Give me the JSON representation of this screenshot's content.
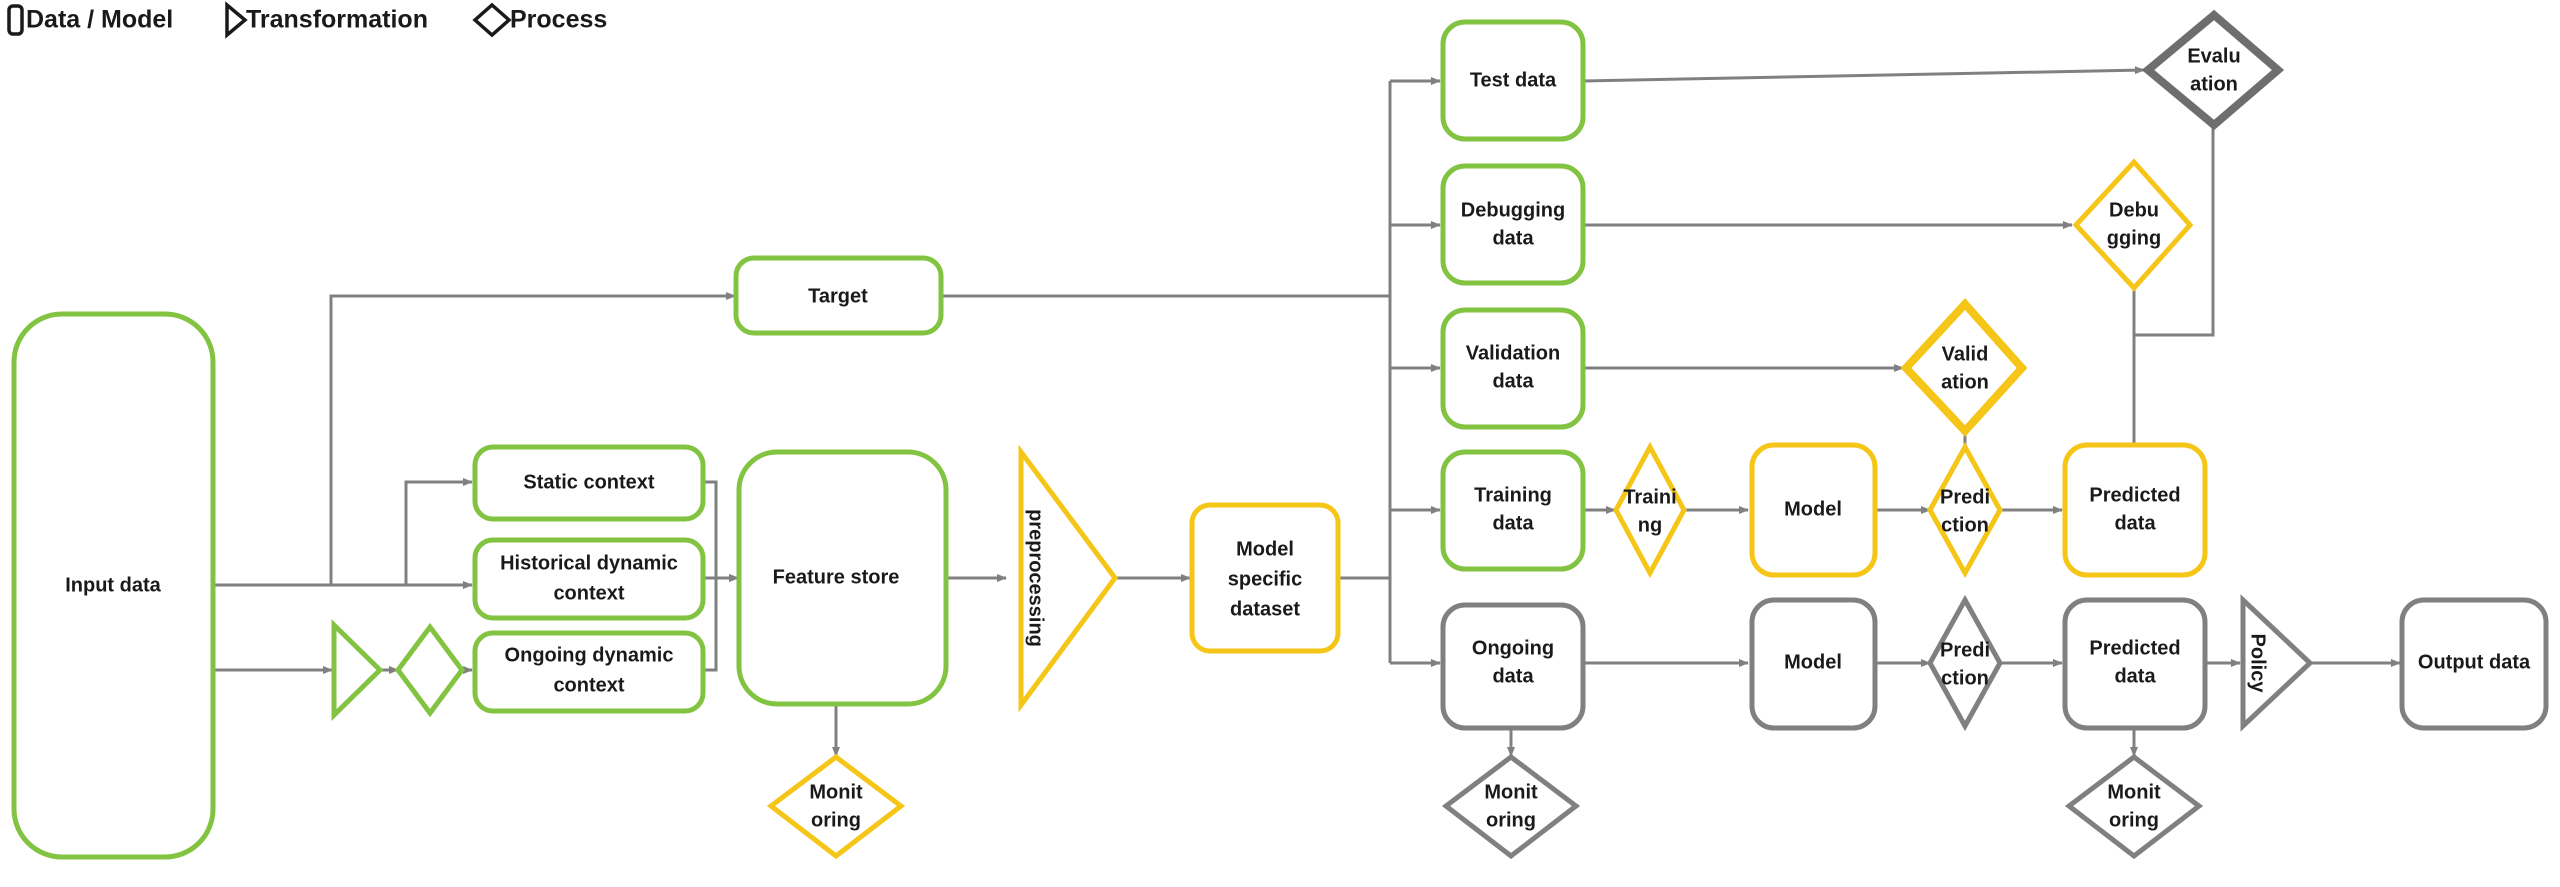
{
  "legend": {
    "items": [
      {
        "id": "data-model",
        "label": "Data / Model",
        "shape": "rounded-rect"
      },
      {
        "id": "transformation",
        "label": "Transformation",
        "shape": "triangle"
      },
      {
        "id": "process",
        "label": "Process",
        "shape": "diamond"
      }
    ]
  },
  "colors": {
    "green": "#82C341",
    "yellow": "#F5C518",
    "gray": "#808080",
    "dark_gray": "#6E6E6E",
    "edge": "#808080",
    "text": "#1A1A1A",
    "background": "#FFFFFF"
  },
  "nodes": {
    "input_data": {
      "label": "Input data",
      "shape": "rounded-rect",
      "color": "green"
    },
    "target": {
      "label": "Target",
      "shape": "rounded-rect",
      "color": "green"
    },
    "static_context": {
      "label": "Static context",
      "shape": "rounded-rect",
      "color": "green"
    },
    "historical_dynamic_context": {
      "label": "Historical dynamic\ncontext",
      "lines": [
        "Historical dynamic",
        "context"
      ],
      "shape": "rounded-rect",
      "color": "green"
    },
    "ongoing_dynamic_context": {
      "label": "Ongoing dynamic\ncontext",
      "lines": [
        "Ongoing dynamic",
        "context"
      ],
      "shape": "rounded-rect",
      "color": "green"
    },
    "ingest_transformation": {
      "label": "",
      "shape": "triangle",
      "color": "green"
    },
    "ingest_process": {
      "label": "",
      "shape": "diamond",
      "color": "green"
    },
    "feature_store": {
      "label": "Feature store",
      "shape": "rounded-rect",
      "color": "green"
    },
    "preprocessing": {
      "label": "preprocessing",
      "shape": "triangle",
      "color": "yellow",
      "rotated_text": true
    },
    "monitoring_feature_store": {
      "label": "Monitoring",
      "lines": [
        "Monit",
        "oring"
      ],
      "shape": "diamond",
      "color": "yellow"
    },
    "model_specific_dataset": {
      "label": "Model specific dataset",
      "lines": [
        "Model",
        "specific",
        "dataset"
      ],
      "shape": "rounded-rect",
      "color": "yellow"
    },
    "test_data": {
      "label": "Test data",
      "shape": "rounded-rect",
      "color": "green"
    },
    "debugging_data": {
      "label": "Debugging data",
      "lines": [
        "Debugging",
        "data"
      ],
      "shape": "rounded-rect",
      "color": "green"
    },
    "validation_data": {
      "label": "Validation data",
      "lines": [
        "Validation",
        "data"
      ],
      "shape": "rounded-rect",
      "color": "green"
    },
    "training_data": {
      "label": "Training data",
      "lines": [
        "Training",
        "data"
      ],
      "shape": "rounded-rect",
      "color": "green"
    },
    "ongoing_data": {
      "label": "Ongoing data",
      "lines": [
        "Ongoing",
        "data"
      ],
      "shape": "rounded-rect",
      "color": "gray"
    },
    "training_process": {
      "label": "Training",
      "lines": [
        "Traini",
        "ng"
      ],
      "shape": "diamond",
      "color": "yellow"
    },
    "model_train": {
      "label": "Model",
      "shape": "rounded-rect",
      "color": "yellow"
    },
    "prediction_train": {
      "label": "Prediction",
      "lines": [
        "Predi",
        "ction"
      ],
      "shape": "diamond",
      "color": "yellow"
    },
    "predicted_data_train": {
      "label": "Predicted data",
      "lines": [
        "Predicted",
        "data"
      ],
      "shape": "rounded-rect",
      "color": "yellow"
    },
    "validation_process": {
      "label": "Validation",
      "lines": [
        "Valid",
        "ation"
      ],
      "shape": "diamond",
      "color": "yellow"
    },
    "debugging_process": {
      "label": "Debugging",
      "lines": [
        "Debu",
        "gging"
      ],
      "shape": "diamond",
      "color": "yellow"
    },
    "evaluation_process": {
      "label": "Evaluation",
      "lines": [
        "Evalu",
        "ation"
      ],
      "shape": "diamond",
      "color": "dark_gray"
    },
    "model_serve": {
      "label": "Model",
      "shape": "rounded-rect",
      "color": "gray"
    },
    "prediction_serve": {
      "label": "Prediction",
      "lines": [
        "Predi",
        "ction"
      ],
      "shape": "diamond",
      "color": "gray"
    },
    "predicted_data_serve": {
      "label": "Predicted data",
      "lines": [
        "Predicted",
        "data"
      ],
      "shape": "rounded-rect",
      "color": "gray"
    },
    "policy": {
      "label": "Policy",
      "shape": "triangle",
      "color": "gray",
      "rotated_text": true
    },
    "output_data": {
      "label": "Output data",
      "shape": "rounded-rect",
      "color": "gray"
    },
    "monitoring_ongoing": {
      "label": "Monitoring",
      "lines": [
        "Monit",
        "oring"
      ],
      "shape": "diamond",
      "color": "gray"
    },
    "monitoring_predicted": {
      "label": "Monitoring",
      "lines": [
        "Monit",
        "oring"
      ],
      "shape": "diamond",
      "color": "gray"
    }
  }
}
